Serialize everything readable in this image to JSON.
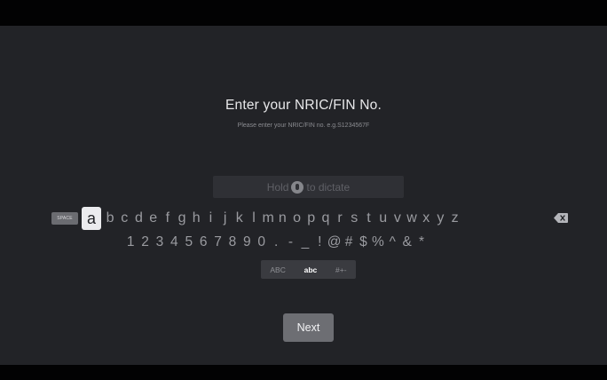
{
  "prompt": {
    "title": "Enter your NRIC/FIN No.",
    "subtitle": "Please enter your NRIC/FIN no. e.g.S1234567F"
  },
  "dictation": {
    "prefix": "Hold",
    "suffix": "to dictate",
    "icon": "mic-icon"
  },
  "keyboard": {
    "space_label": "SPACE",
    "focused_key": "a",
    "letters": [
      "a",
      "b",
      "c",
      "d",
      "e",
      "f",
      "g",
      "h",
      "i",
      "j",
      "k",
      "l",
      "m",
      "n",
      "o",
      "p",
      "q",
      "r",
      "s",
      "t",
      "u",
      "v",
      "w",
      "x",
      "y",
      "z"
    ],
    "numbers_symbols": [
      "1",
      "2",
      "3",
      "4",
      "5",
      "6",
      "7",
      "8",
      "9",
      "0",
      ".",
      "-",
      "_",
      "!",
      "@",
      "#",
      "$",
      "%",
      "^",
      "&",
      "*"
    ],
    "backspace_icon": "backspace-icon",
    "modes": [
      "ABC",
      "abc",
      "#+-"
    ],
    "active_mode": "abc"
  },
  "actions": {
    "next_label": "Next"
  },
  "colors": {
    "background": "#222327",
    "focused_key": "#ebebee",
    "button": "#6d6e73"
  }
}
